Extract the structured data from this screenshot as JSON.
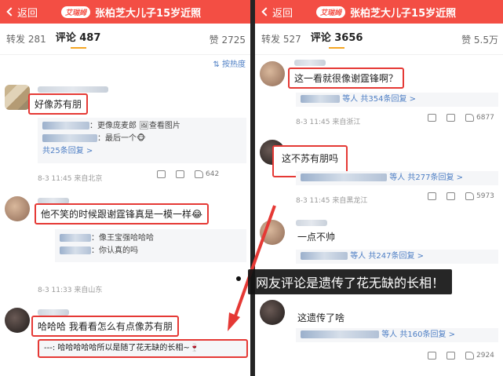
{
  "left": {
    "back_label": "返回",
    "badge": "艾瑞姆",
    "title": "张柏芝大儿子15岁近照",
    "tabs": {
      "repost": "转发 281",
      "comment": "评论 487",
      "like": "赞 2725"
    },
    "sort_label": "按热度",
    "comments": [
      {
        "text": "好像苏有朋",
        "replies": [
          "：更像庞麦郎 🖼查看图片",
          "：最后一个🐵"
        ],
        "more": "共25条回复 >",
        "meta": "8-3 11:45  来自北京",
        "like_count": "642"
      },
      {
        "text": "他不笑的时候跟谢霆锋真是一模一样😂",
        "replies": [
          "：像王宝强哈哈哈",
          "：你认真的吗"
        ],
        "meta": "8-3 11:33  来自山东"
      },
      {
        "text": "哈哈哈 我看看怎么有点像苏有朋",
        "reply_box": "---: 哈哈哈哈哈所以是随了花无缺的长相~🍷"
      }
    ]
  },
  "right": {
    "back_label": "返回",
    "badge": "艾瑞姆",
    "title": "张柏芝大儿子15岁近照",
    "tabs": {
      "repost": "转发 527",
      "comment": "评论 3656",
      "like": "赞 5.5万"
    },
    "comments": [
      {
        "text": "这一看就很像谢霆锋啊？",
        "more": "等人  共354条回复 >",
        "meta": "8-3 11:45  来自浙江",
        "like_count": "6877"
      },
      {
        "text": "这不苏有朋吗",
        "more": "等人  共277条回复 >",
        "meta": "8-3 11:45  来自黑龙江",
        "like_count": "5973"
      },
      {
        "text": "一点不帅",
        "more": "等人  共247条回复 >"
      },
      {
        "text": "这遗传了啥",
        "more": "等人  共160条回复 >",
        "like_count": "2924"
      }
    ]
  },
  "caption": "网友评论是遗传了花无缺的长相！",
  "colors": {
    "header_red": "#f34e44",
    "highlight_red": "#e53935",
    "link_blue": "#4d7ec4"
  }
}
